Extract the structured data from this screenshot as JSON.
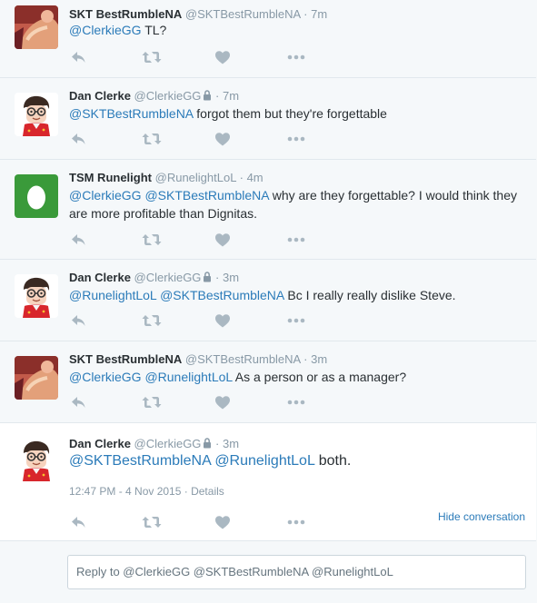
{
  "tweets": [
    {
      "name": "SKT BestRumbleNA",
      "handle": "@SKTBestRumbleNA",
      "dot": "·",
      "time": "7m",
      "mentions": [
        "@ClerkieGG"
      ],
      "text": "TL?"
    },
    {
      "name": "Dan Clerke",
      "handle": "@ClerkieGG",
      "dot": "·",
      "time": "7m",
      "mentions": [
        "@SKTBestRumbleNA"
      ],
      "text": "forgot them but they're forgettable"
    },
    {
      "name": "TSM Runelight",
      "handle": "@RunelightLoL",
      "dot": "·",
      "time": "4m",
      "mentions": [
        "@ClerkieGG",
        "@SKTBestRumbleNA"
      ],
      "text": "why are they forgettable? I would think they are more profitable than Dignitas."
    },
    {
      "name": "Dan Clerke",
      "handle": "@ClerkieGG",
      "dot": "·",
      "time": "3m",
      "mentions": [
        "@RunelightLoL",
        "@SKTBestRumbleNA"
      ],
      "text": "Bc I really really dislike Steve."
    },
    {
      "name": "SKT BestRumbleNA",
      "handle": "@SKTBestRumbleNA",
      "dot": "·",
      "time": "3m",
      "mentions": [
        "@ClerkieGG",
        "@RunelightLoL"
      ],
      "text": "As a person or as a manager?"
    },
    {
      "name": "Dan Clerke",
      "handle": "@ClerkieGG",
      "dot": "·",
      "time": "3m",
      "mentions": [
        "@SKTBestRumbleNA",
        "@RunelightLoL"
      ],
      "text": "both.",
      "timestamp": "12:47 PM - 4 Nov 2015",
      "meta_dot": "·",
      "details": "Details",
      "hide_conversation": "Hide conversation"
    }
  ],
  "reply": {
    "placeholder": "Reply to @ClerkieGG @SKTBestRumbleNA @RunelightLoL"
  },
  "colors": {
    "link": "#2b7bb9",
    "muted": "#8899a6",
    "action_icon": "#aab8c2",
    "egg_bg": "#3a9a3a"
  },
  "icons": [
    "reply-icon",
    "retweet-icon",
    "like-icon",
    "more-icon",
    "lock-icon"
  ]
}
